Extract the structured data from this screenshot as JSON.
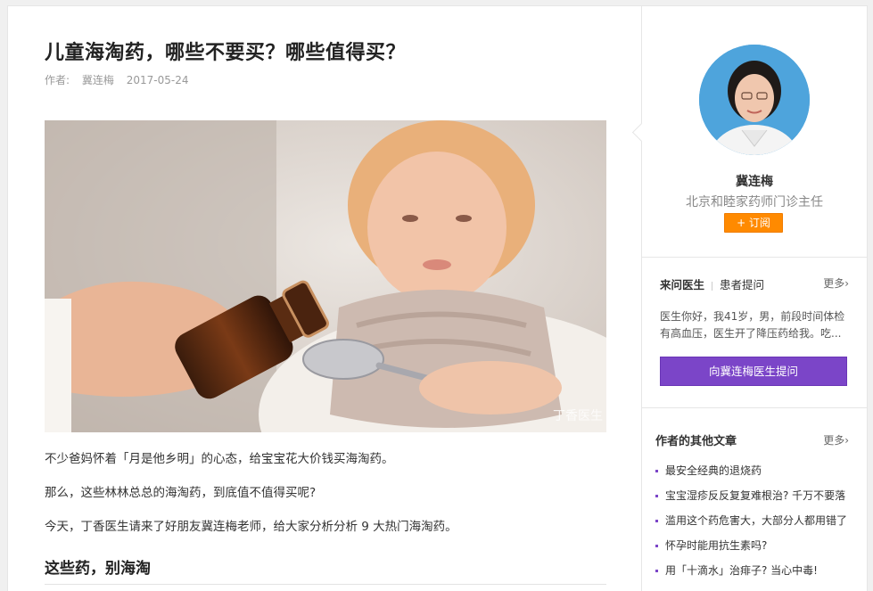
{
  "article": {
    "title": "儿童海淘药，哪些不要买？哪些值得买？",
    "author_label": "作者:",
    "author": "冀连梅",
    "date": "2017-05-24",
    "hero_watermark": "丁香医生",
    "paragraphs": [
      "不少爸妈怀着「月是他乡明」的心态，给宝宝花大价钱买海淘药。",
      "那么，这些林林总总的海淘药，到底值不值得买呢?",
      "今天，丁香医生请来了好朋友冀连梅老师，给大家分析分析 9 大热门海淘药。"
    ],
    "section_heading": "这些药，别海淘"
  },
  "sidebar": {
    "doctor_name": "冀连梅",
    "doctor_title": "北京和睦家药师门诊主任",
    "subscribe_label": "+ 订阅",
    "qa": {
      "tab_ask": "来问医生",
      "tab_patient": "患者提问",
      "more": "更多›",
      "question": "医生你好，我41岁，男，前段时间体检有高血压，医生开了降压药给我。吃...",
      "ask_button": "向冀连梅医生提问"
    },
    "other_articles": {
      "title": "作者的其他文章",
      "more": "更多›",
      "items": [
        "最安全经典的退烧药",
        "宝宝湿疹反反复复难根治? 千万不要落",
        "滥用这个药危害大，大部分人都用错了",
        "怀孕时能用抗生素吗?",
        "用「十滴水」治痱子? 当心中毒!"
      ]
    }
  },
  "colors": {
    "subscribe_orange": "#ff8a00",
    "ask_purple": "#7b45c8"
  }
}
